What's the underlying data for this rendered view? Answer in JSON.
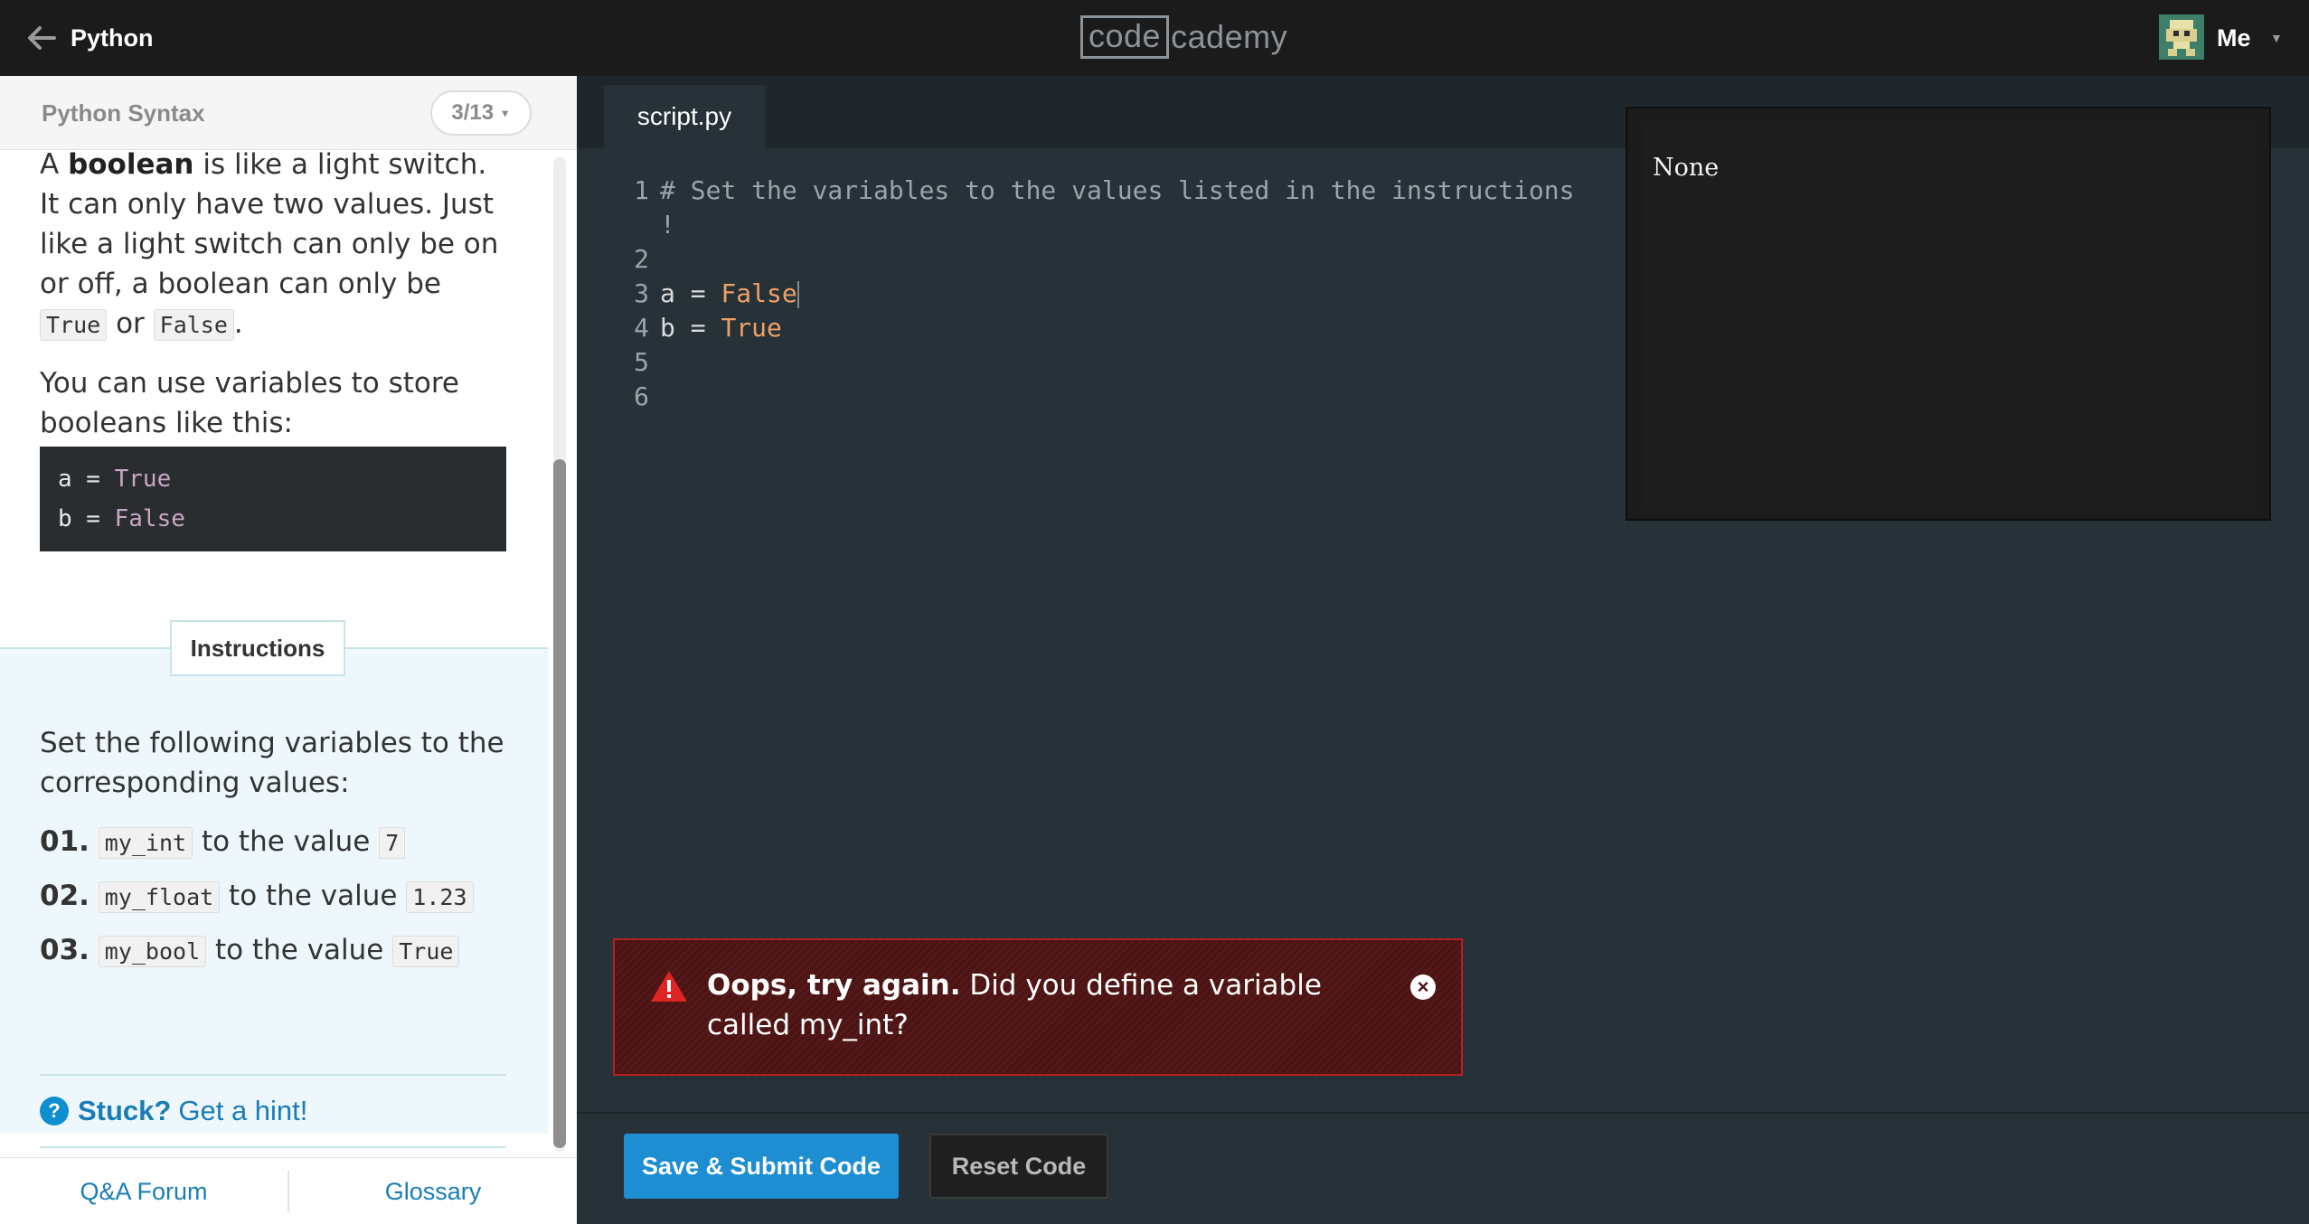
{
  "topbar": {
    "course_title": "Python",
    "logo_box": "code",
    "logo_rest": "cademy",
    "user_label": "Me"
  },
  "lesson": {
    "title": "Python Syntax",
    "progress": "3/13",
    "para1_a": "A ",
    "para1_bold": "boolean",
    "para1_b": " is like a light switch. It can only have two values. Just like a light switch can only be on or off, a boolean can only be ",
    "para1_true": "True",
    "para1_or": " or ",
    "para1_false": "False",
    "para1_end": ".",
    "para2": "You can use variables to store booleans like this:",
    "example_lines": [
      {
        "var": "a",
        "op": " = ",
        "val": "True"
      },
      {
        "var": "b",
        "op": " = ",
        "val": "False"
      }
    ]
  },
  "instructions": {
    "tab_label": "Instructions",
    "text": "Set the following variables to the corresponding values:",
    "tasks": [
      {
        "num": "01.",
        "var": "my_int",
        "mid": " to the value ",
        "val": "7"
      },
      {
        "num": "02.",
        "var": "my_float",
        "mid": " to the value ",
        "val": "1.23"
      },
      {
        "num": "03.",
        "var": "my_bool",
        "mid": " to the value ",
        "val": "True"
      }
    ],
    "hint_icon": "?",
    "hint_stuck": "Stuck?",
    "hint_link": "Get a hint!"
  },
  "footer": {
    "qa_label": "Q&A Forum",
    "glossary_label": "Glossary"
  },
  "editor": {
    "tab_label": "script.py",
    "line_numbers": [
      "1",
      "2",
      "3",
      "4",
      "5",
      "6"
    ],
    "line1_comment": "# Set the variables to the values listed in the instructions",
    "line1_wrap": "!",
    "line3_prefix": "a = ",
    "line3_value": "False",
    "line4_prefix": "b = ",
    "line4_value": "True"
  },
  "output": {
    "text": "None"
  },
  "error": {
    "title": "Oops, try again.",
    "message": " Did you define a variable called my_int?",
    "close_glyph": "×"
  },
  "buttons": {
    "submit_label": "Save & Submit Code",
    "reset_label": "Reset Code"
  },
  "colors": {
    "accent_blue": "#1c8ed1",
    "error_red": "#b72020",
    "editor_bg": "#263238",
    "keyword_orange": "#f0a066"
  },
  "icons": {
    "back": "arrow-left-icon",
    "avatar": "avatar-icon",
    "caret": "caret-down-icon",
    "warning": "warning-triangle-icon",
    "close": "close-circle-icon",
    "hint": "question-circle-icon"
  }
}
